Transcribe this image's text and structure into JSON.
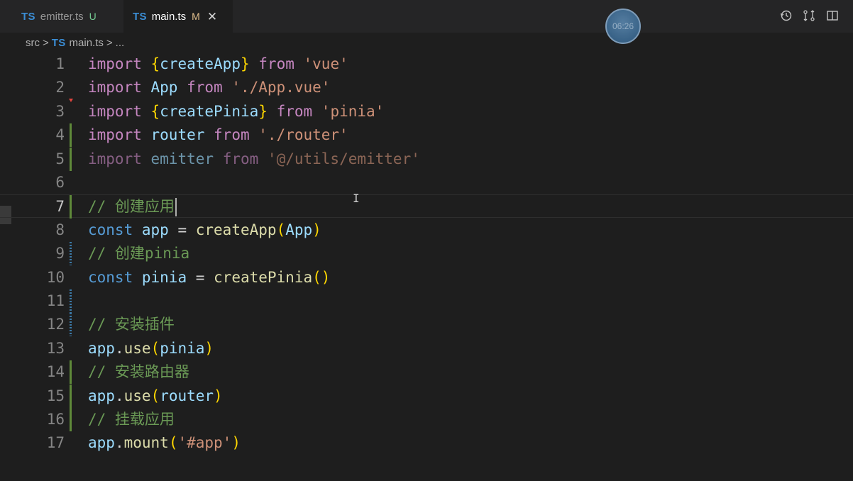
{
  "tabs": [
    {
      "badge": "TS",
      "label": "emitter.ts",
      "status": "U",
      "active": false
    },
    {
      "badge": "TS",
      "label": "main.ts",
      "status": "M",
      "active": true,
      "close": "✕"
    }
  ],
  "clock_text": "06:26",
  "breadcrumb": {
    "folder": "src",
    "sep": ">",
    "badge": "TS",
    "file": "main.ts",
    "more": "..."
  },
  "toolbar": {
    "timeline_icon": "history-icon",
    "compare_icon": "compare-changes-icon",
    "split_icon": "split-editor-icon"
  },
  "colors": {
    "keyword": "#569cd6",
    "variable": "#9cdcfe",
    "function": "#dcdcaa",
    "string": "#ce9178",
    "comment": "#6a9955",
    "bracket1": "#ffd700",
    "bracket2": "#da70d6",
    "gutter_modified": "#5f8a3a",
    "gutter_added": "#3c7aa8"
  },
  "editor": {
    "lines": [
      {
        "num": "1",
        "tokens": [
          [
            "import",
            "kw2"
          ],
          [
            " ",
            "pl"
          ],
          [
            "{",
            "br1"
          ],
          [
            "createApp",
            "var"
          ],
          [
            "}",
            "br1"
          ],
          [
            " ",
            "pl"
          ],
          [
            "from",
            "kw2"
          ],
          [
            " ",
            "pl"
          ],
          [
            "'vue'",
            "str"
          ]
        ]
      },
      {
        "num": "2",
        "tokens": [
          [
            "import",
            "kw2"
          ],
          [
            " ",
            "pl"
          ],
          [
            "App",
            "var"
          ],
          [
            " ",
            "pl"
          ],
          [
            "from",
            "kw2"
          ],
          [
            " ",
            "pl"
          ],
          [
            "'./App.vue'",
            "str"
          ]
        ]
      },
      {
        "num": "3",
        "tokens": [
          [
            "import",
            "kw2"
          ],
          [
            " ",
            "pl"
          ],
          [
            "{",
            "br1"
          ],
          [
            "createPinia",
            "var"
          ],
          [
            "}",
            "br1"
          ],
          [
            " ",
            "pl"
          ],
          [
            "from",
            "kw2"
          ],
          [
            " ",
            "pl"
          ],
          [
            "'pinia'",
            "str"
          ]
        ]
      },
      {
        "num": "4",
        "gutter": "modified",
        "tokens": [
          [
            "import",
            "kw2"
          ],
          [
            " ",
            "pl"
          ],
          [
            "router",
            "var"
          ],
          [
            " ",
            "pl"
          ],
          [
            "from",
            "kw2"
          ],
          [
            " ",
            "pl"
          ],
          [
            "'./router'",
            "str"
          ]
        ]
      },
      {
        "num": "5",
        "gutter": "modified",
        "dim": true,
        "tokens": [
          [
            "import",
            "kw2"
          ],
          [
            " ",
            "pl"
          ],
          [
            "emitter",
            "var"
          ],
          [
            " ",
            "pl"
          ],
          [
            "from",
            "kw2"
          ],
          [
            " ",
            "pl"
          ],
          [
            "'@/utils/emitter'",
            "str"
          ]
        ]
      },
      {
        "num": "6",
        "tokens": []
      },
      {
        "num": "7",
        "gutter": "modified",
        "current": true,
        "caret": true,
        "tokens": [
          [
            "// 创建应用",
            "cm"
          ]
        ]
      },
      {
        "num": "8",
        "tokens": [
          [
            "const",
            "kw"
          ],
          [
            " ",
            "pl"
          ],
          [
            "app",
            "var"
          ],
          [
            " = ",
            "pl"
          ],
          [
            "createApp",
            "fn"
          ],
          [
            "(",
            "br1"
          ],
          [
            "App",
            "var"
          ],
          [
            ")",
            "br1"
          ]
        ]
      },
      {
        "num": "9",
        "gutter": "added-stripe",
        "tokens": [
          [
            "// 创建pinia",
            "cm"
          ]
        ]
      },
      {
        "num": "10",
        "tokens": [
          [
            "const",
            "kw"
          ],
          [
            " ",
            "pl"
          ],
          [
            "pinia",
            "var"
          ],
          [
            " = ",
            "pl"
          ],
          [
            "createPinia",
            "fn"
          ],
          [
            "()",
            "br1"
          ]
        ]
      },
      {
        "num": "11",
        "gutter": "added-stripe",
        "tokens": []
      },
      {
        "num": "12",
        "gutter": "added-stripe",
        "tokens": [
          [
            "// 安装插件",
            "cm"
          ]
        ]
      },
      {
        "num": "13",
        "tokens": [
          [
            "app",
            "var"
          ],
          [
            ".",
            "pl"
          ],
          [
            "use",
            "fn"
          ],
          [
            "(",
            "br1"
          ],
          [
            "pinia",
            "var"
          ],
          [
            ")",
            "br1"
          ]
        ]
      },
      {
        "num": "14",
        "gutter": "modified",
        "tokens": [
          [
            "// 安装路由器",
            "cm"
          ]
        ]
      },
      {
        "num": "15",
        "gutter": "modified",
        "tokens": [
          [
            "app",
            "var"
          ],
          [
            ".",
            "pl"
          ],
          [
            "use",
            "fn"
          ],
          [
            "(",
            "br1"
          ],
          [
            "router",
            "var"
          ],
          [
            ")",
            "br1"
          ]
        ]
      },
      {
        "num": "16",
        "gutter": "modified",
        "tokens": [
          [
            "// 挂载应用",
            "cm"
          ]
        ]
      },
      {
        "num": "17",
        "tokens": [
          [
            "app",
            "var"
          ],
          [
            ".",
            "pl"
          ],
          [
            "mount",
            "fn"
          ],
          [
            "(",
            "br1"
          ],
          [
            "'#app'",
            "str"
          ],
          [
            ")",
            "br1"
          ]
        ]
      }
    ]
  }
}
